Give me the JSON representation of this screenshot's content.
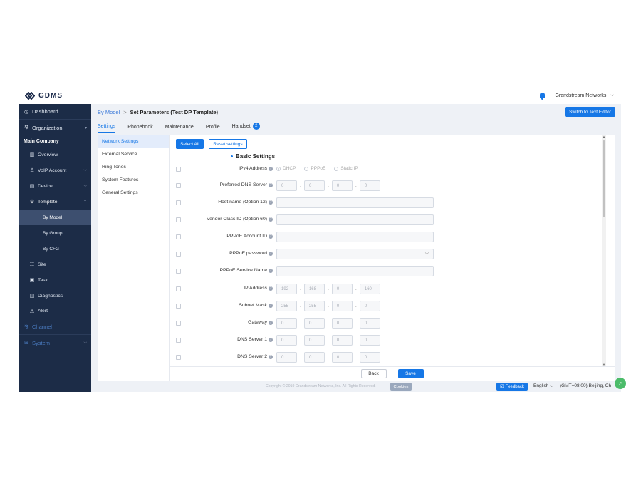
{
  "header": {
    "logo_text": "GDMS",
    "account_name": "Grandstream Networks",
    "account_chevron": "⌵"
  },
  "sidebar": {
    "dashboard": "Dashboard",
    "organization": "Organization",
    "company": "Main Company",
    "overview": "Overview",
    "voip_account": "VoIP Account",
    "device": "Device",
    "template": "Template",
    "by_model": "By Model",
    "by_group": "By Group",
    "by_cfg": "By CFG",
    "site": "Site",
    "task": "Task",
    "diagnostics": "Diagnostics",
    "alert": "Alert",
    "channel": "Channel",
    "system": "System"
  },
  "breadcrumb": {
    "link": "By Model",
    "separator": ">",
    "title": "Set Parameters (Test DP Template)"
  },
  "switch_button": "Switch to Text Editor",
  "tabs": {
    "settings": "Settings",
    "phonebook": "Phonebook",
    "maintenance": "Maintenance",
    "profile": "Profile",
    "handset": "Handset",
    "handset_badge": "2"
  },
  "subnav": {
    "network": "Network Settings",
    "external": "External Service",
    "ringtones": "Ring Tones",
    "system_features": "System Features",
    "general": "General Settings"
  },
  "toolbar": {
    "select_all": "Select All",
    "reset": "Reset settings"
  },
  "section_title": "Basic Settings",
  "fields": {
    "ipv4": "IPv4 Address",
    "ipv4_options": [
      "DHCP",
      "PPPoE",
      "Static IP"
    ],
    "pref_dns": "Preferred DNS Server",
    "hostname": "Host name (Option 12)",
    "vendor_class": "Vendor Class ID (Option 60)",
    "pppoe_id": "PPPoE Account ID",
    "pppoe_pw": "PPPoE password",
    "pppoe_service": "PPPoE Service Name",
    "ip_address": "IP Address",
    "subnet": "Subnet Mask",
    "gateway": "Gateway",
    "dns1": "DNS Server 1",
    "dns2": "DNS Server 2",
    "help_glyph": "?",
    "pref_dns_values": [
      "0",
      "0",
      "0",
      "0"
    ],
    "ip_values": [
      "192",
      "168",
      "0",
      "160"
    ],
    "subnet_values": [
      "255",
      "255",
      "0",
      "0"
    ],
    "gateway_values": [
      "0",
      "0",
      "0",
      "0"
    ],
    "dns1_values": [
      "0",
      "0",
      "0",
      "0"
    ],
    "dns2_values": [
      "0",
      "0",
      "0",
      "0"
    ]
  },
  "actions": {
    "back": "Back",
    "save": "Save"
  },
  "footer": {
    "copyright": "Copyright © 2019 Grandstream Networks, Inc. All Rights Reserved.",
    "cookies": "Cookies",
    "feedback": "Feedback",
    "language": "English ⌵",
    "timezone": "(GMT+08:00) Beijing, Ch"
  },
  "colors": {
    "primary": "#1677e6",
    "sidebar_bg": "#1c2c47",
    "sidebar_active": "#3d4f6f",
    "page_bg": "#eef1f6"
  }
}
